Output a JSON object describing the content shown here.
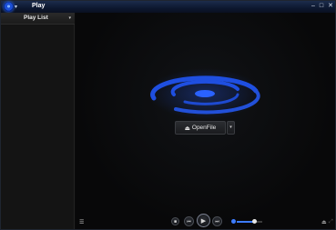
{
  "window": {
    "title": "Play",
    "menu_caret": "▾",
    "controls": {
      "minimize": "–",
      "maximize": "□",
      "close": "✕"
    }
  },
  "sidebar": {
    "title": "Play List",
    "caret": "▾"
  },
  "main": {
    "open_button": {
      "icon": "⏏",
      "label": "OpenFile",
      "dropdown": "▾"
    }
  },
  "controls": {
    "playlist_toggle": "☰",
    "stop": "■",
    "previous": "⏮",
    "play": "▶",
    "next": "⏭",
    "volume_level": 0.68,
    "eject": "⏏",
    "fullscreen": "⤢"
  },
  "colors": {
    "accent": "#3d7cff",
    "disc_blue": "#1f4fe0",
    "background": "#0a0a0b"
  }
}
